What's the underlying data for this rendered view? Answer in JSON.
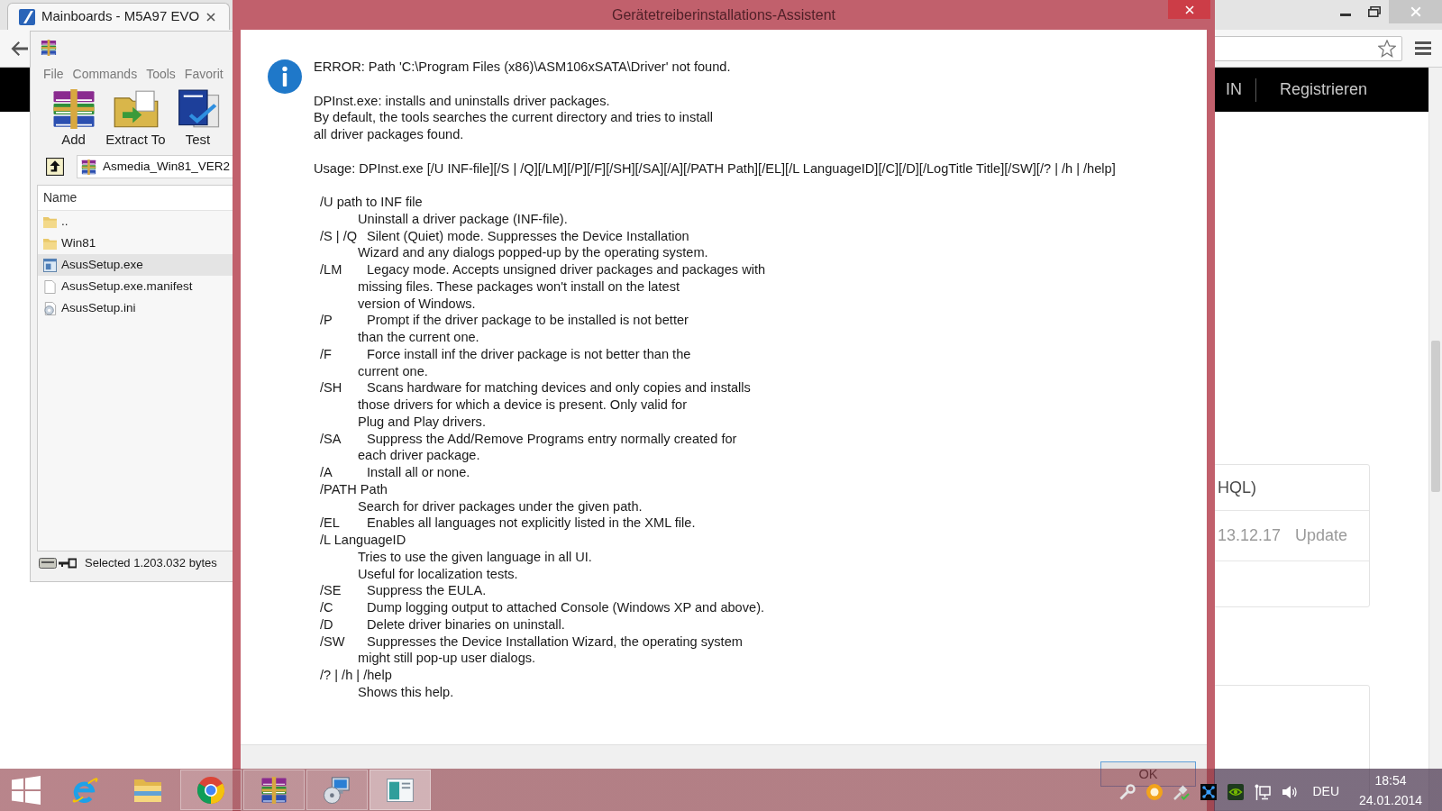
{
  "browser": {
    "tab_title": "Mainboards - M5A97 EVO",
    "nav_links": [
      "IN",
      "Registrieren"
    ],
    "card_rows": [
      {
        "kind": "title",
        "cells": [
          "HQL)"
        ]
      },
      {
        "kind": "meta",
        "cells": [
          "13.12.17",
          "Update"
        ]
      }
    ]
  },
  "archiver": {
    "menu": [
      "File",
      "Commands",
      "Tools",
      "Favorit"
    ],
    "toolbar": [
      {
        "kind": "add",
        "label": "Add"
      },
      {
        "kind": "extract",
        "label": "Extract To"
      },
      {
        "kind": "test",
        "label": "Test"
      }
    ],
    "path": "Asmedia_Win81_VER2",
    "column": "Name",
    "files": [
      {
        "kind": "folder",
        "name": "..",
        "selected": false
      },
      {
        "kind": "folder",
        "name": "Win81",
        "selected": false
      },
      {
        "kind": "exe",
        "name": "AsusSetup.exe",
        "selected": true
      },
      {
        "kind": "file",
        "name": "AsusSetup.exe.manifest",
        "selected": false
      },
      {
        "kind": "ini",
        "name": "AsusSetup.ini",
        "selected": false
      }
    ],
    "status": "Selected 1.203.032 bytes"
  },
  "dialog": {
    "title": "Gerätetreiberinstallations-Assistent",
    "error": "ERROR: Path 'C:\\Program Files (x86)\\ASM106xSATA\\Driver' not found.",
    "intro": [
      "DPInst.exe: installs and uninstalls driver packages.",
      "By default, the tools searches the current directory and tries to install",
      "all driver packages found."
    ],
    "usage": "Usage: DPInst.exe [/U INF-file][/S | /Q][/LM][/P][/F][/SH][/SA][/A][/PATH Path][/EL][/L LanguageID][/C][/D][/LogTitle Title][/SW][/? | /h | /help]",
    "options": [
      {
        "kind": "block",
        "flag": "/U path to INF file",
        "lines": [
          "Uninstall a driver package (INF-file)."
        ]
      },
      {
        "kind": "inline",
        "flag": "/S | /Q",
        "lines": [
          "Silent (Quiet) mode. Suppresses the Device Installation",
          "Wizard and any dialogs popped-up by the operating system."
        ]
      },
      {
        "kind": "inline",
        "flag": "/LM",
        "lines": [
          "Legacy mode. Accepts unsigned driver packages and packages with",
          "missing files. These packages won't install on the latest",
          "version of Windows."
        ]
      },
      {
        "kind": "inline",
        "flag": "/P",
        "lines": [
          "Prompt if the driver package to be installed is not better",
          "than the current one."
        ]
      },
      {
        "kind": "inline",
        "flag": "/F",
        "lines": [
          "Force install inf the driver package is not better than the",
          "current one."
        ]
      },
      {
        "kind": "inline",
        "flag": "/SH",
        "lines": [
          "Scans hardware for matching devices and only copies and installs",
          "those drivers for which a device is present. Only valid for",
          "Plug and Play drivers."
        ]
      },
      {
        "kind": "inline",
        "flag": "/SA",
        "lines": [
          "Suppress the Add/Remove Programs entry normally created for",
          "each driver package."
        ]
      },
      {
        "kind": "inline",
        "flag": "/A",
        "lines": [
          "Install all or none."
        ]
      },
      {
        "kind": "block",
        "flag": "/PATH Path",
        "lines": [
          "Search for driver packages under the given path."
        ]
      },
      {
        "kind": "inline",
        "flag": "/EL",
        "lines": [
          "Enables all languages not explicitly listed in the XML file."
        ]
      },
      {
        "kind": "block",
        "flag": "/L LanguageID",
        "lines": [
          "Tries to use the given language in all UI.",
          "Useful for localization tests."
        ]
      },
      {
        "kind": "inline",
        "flag": "/SE",
        "lines": [
          "Suppress the EULA."
        ]
      },
      {
        "kind": "inline",
        "flag": "/C",
        "lines": [
          "Dump logging output to attached Console (Windows XP and above)."
        ]
      },
      {
        "kind": "inline",
        "flag": "/D",
        "lines": [
          "Delete driver binaries on uninstall."
        ]
      },
      {
        "kind": "inline",
        "flag": "/SW",
        "lines": [
          "Suppresses the Device Installation Wizard, the operating system",
          "might still pop-up user dialogs."
        ]
      },
      {
        "kind": "block",
        "flag": "/? | /h | /help",
        "lines": [
          "Shows this help."
        ]
      }
    ],
    "buttons": [
      {
        "label": "OK"
      }
    ]
  },
  "taskbar": {
    "apps": [
      {
        "kind": "ie",
        "running": false,
        "selected": false
      },
      {
        "kind": "explorer",
        "running": false,
        "selected": false
      },
      {
        "kind": "chrome",
        "running": true,
        "selected": false
      },
      {
        "kind": "archiver",
        "running": true,
        "selected": false
      },
      {
        "kind": "setup",
        "running": true,
        "selected": false
      },
      {
        "kind": "window",
        "running": true,
        "selected": true
      }
    ],
    "language": "DEU",
    "time": "18:54",
    "date": "24.01.2014"
  }
}
